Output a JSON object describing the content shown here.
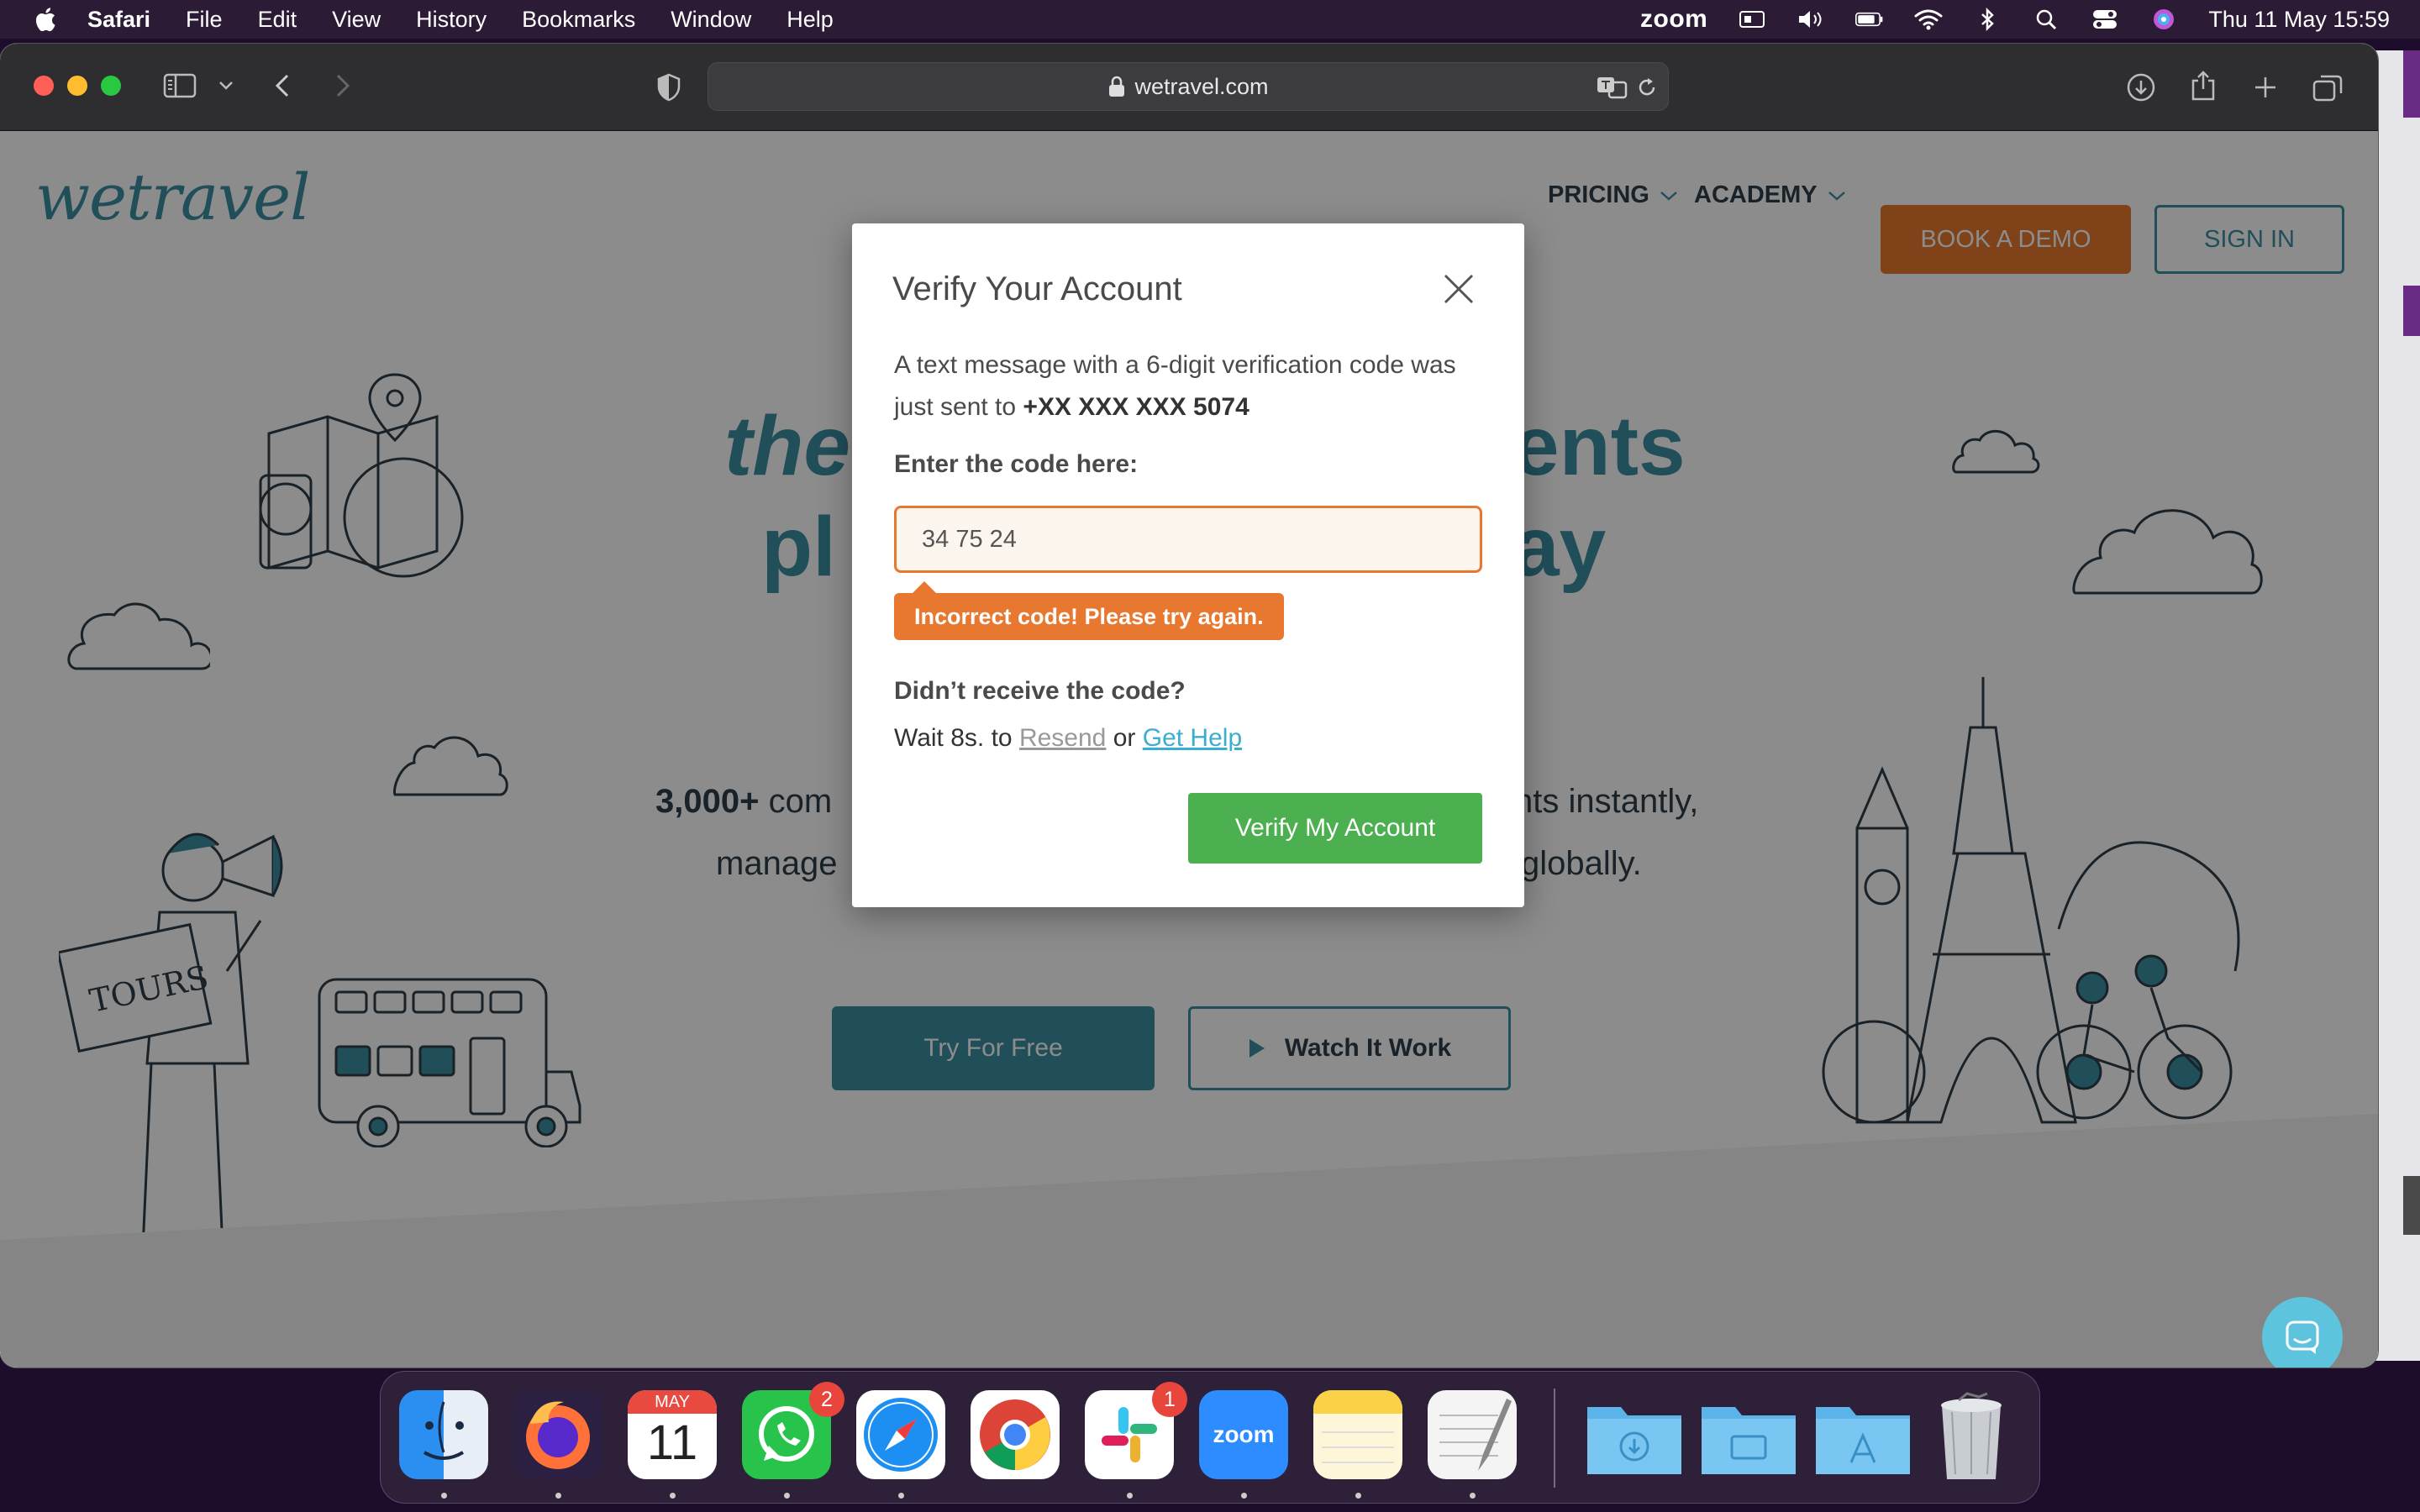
{
  "menubar": {
    "app_name": "Safari",
    "items": [
      "File",
      "Edit",
      "View",
      "History",
      "Bookmarks",
      "Window",
      "Help"
    ],
    "zoom_label": "zoom",
    "clock": "Thu 11 May  15:59"
  },
  "browser": {
    "url": "wetravel.com"
  },
  "site": {
    "logo": "wetravel",
    "nav": [
      "PRICING",
      "ACADEMY"
    ],
    "book_demo": "BOOK A DEMO",
    "sign_in": "SIGN IN",
    "hero_line1_left": "the",
    "hero_line1_right": "ents",
    "hero_line2_left": "pl",
    "hero_line2_right": "ay",
    "sub_line1_bold": "3,000+",
    "sub_line1_left": " com",
    "sub_line1_right": "nts instantly,",
    "sub_line2_left": "manage",
    "sub_line2_right": "globally.",
    "try_free": "Try For Free",
    "watch": "Watch It Work",
    "sign_text": "TOURS"
  },
  "modal": {
    "title": "Verify Your Account",
    "message": "A text message with a 6-digit verification code was just sent to",
    "phone": "+XX XXX XXX 5074",
    "code_label": "Enter the code here:",
    "code_value": "34 75 24",
    "error": "Incorrect code! Please try again.",
    "didnt_receive": "Didn’t receive the code?",
    "wait_prefix": "Wait 8s. to",
    "resend": "Resend",
    "or": "or",
    "get_help": "Get Help",
    "verify_button": "Verify My Account"
  },
  "dock": {
    "calendar_month": "MAY",
    "calendar_day": "11",
    "whatsapp_badge": "2",
    "slack_badge": "1",
    "zoom_label": "zoom"
  },
  "colors": {
    "brand_teal": "#3b8fa3",
    "brand_orange": "#e8782f",
    "verify_green": "#4caf50"
  }
}
